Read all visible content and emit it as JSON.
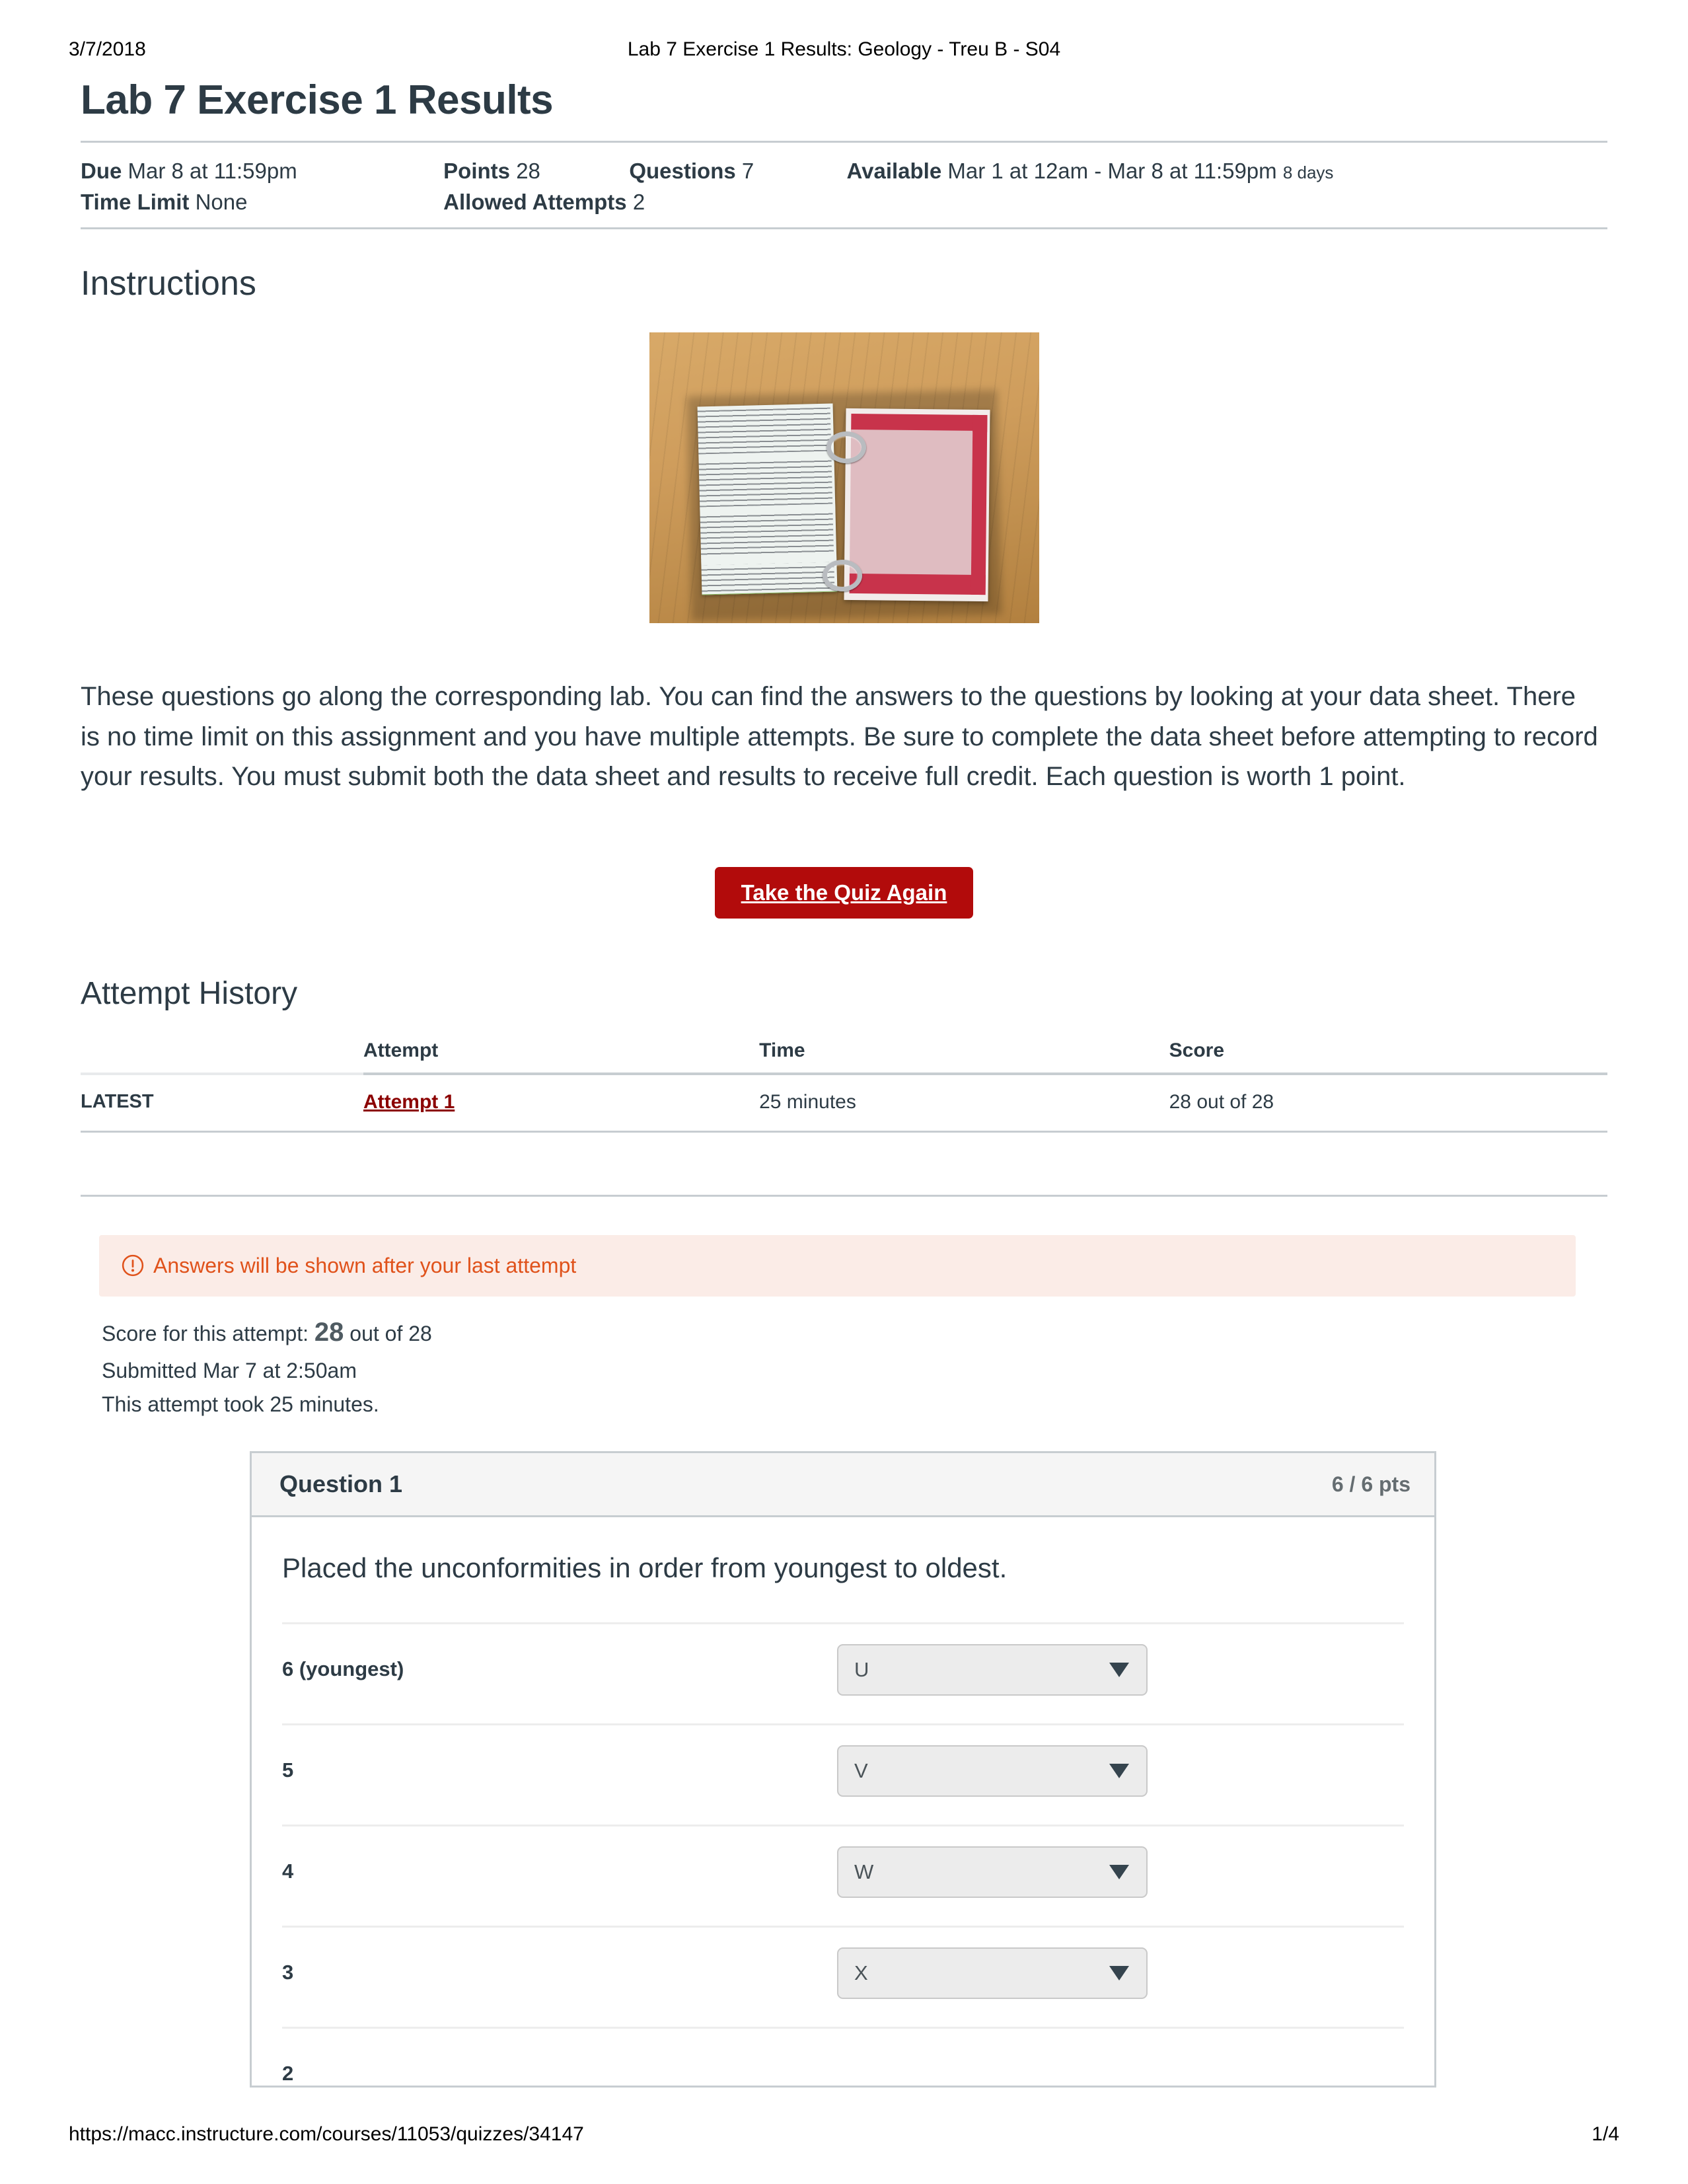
{
  "print_header": {
    "date": "3/7/2018",
    "title": "Lab 7 Exercise 1 Results: Geology - Treu B - S04"
  },
  "print_footer": {
    "url": "https://macc.instructure.com/courses/11053/quizzes/34147",
    "page": "1/4"
  },
  "quiz": {
    "title": "Lab 7 Exercise 1 Results",
    "meta": {
      "due_label": "Due",
      "due_value": "Mar 8 at 11:59pm",
      "points_label": "Points",
      "points_value": "28",
      "questions_label": "Questions",
      "questions_value": "7",
      "available_label": "Available",
      "available_value": "Mar 1 at 12am - Mar 8 at 11:59pm",
      "available_days": "8 days",
      "time_limit_label": "Time Limit",
      "time_limit_value": "None",
      "allowed_attempts_label": "Allowed Attempts",
      "allowed_attempts_value": "2"
    }
  },
  "instructions": {
    "heading": "Instructions",
    "image_alt": "lab-data-sheet-photo",
    "body": "These questions go along the corresponding lab. You can find the answers to the questions by looking at your data sheet. There is no time limit on this assignment and you have multiple attempts. Be sure to complete the data sheet before attempting to record your results. You must submit both the data sheet and results to receive full credit. Each question is worth 1 point."
  },
  "take_quiz_button": {
    "label": "Take the Quiz Again"
  },
  "attempt_history": {
    "heading": "Attempt History",
    "columns": [
      "",
      "Attempt",
      "Time",
      "Score"
    ],
    "rows": [
      {
        "kept": "LATEST",
        "attempt": "Attempt 1",
        "time": "25 minutes",
        "score": "28 out of 28"
      }
    ]
  },
  "alert": {
    "icon": "warning-circle-icon",
    "text": "Answers will be shown after your last attempt"
  },
  "attempt_summary": {
    "score_prefix": "Score for this attempt:",
    "score_value": "28",
    "score_suffix": "out of 28",
    "submitted": "Submitted Mar 7 at 2:50am",
    "duration": "This attempt took 25 minutes."
  },
  "question": {
    "name": "Question 1",
    "points": "6 / 6 pts",
    "text": "Placed the unconformities in order from youngest to oldest.",
    "answers": [
      {
        "label": "6 (youngest)",
        "value": "U"
      },
      {
        "label": "5",
        "value": "V"
      },
      {
        "label": "4",
        "value": "W"
      },
      {
        "label": "3",
        "value": "X"
      },
      {
        "label": "2",
        "value": ""
      }
    ]
  },
  "colors": {
    "brand_red": "#b20b0b",
    "link_red": "#8b0000",
    "alert_orange": "#e0521b",
    "alert_bg": "#fbece7",
    "border_gray": "#c7cdd1",
    "header_bg": "#f5f5f5",
    "select_bg": "#ececec",
    "text": "#2d3b45"
  }
}
